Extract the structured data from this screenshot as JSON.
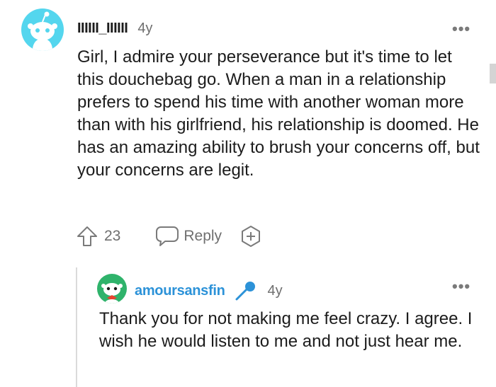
{
  "comment": {
    "username": "IIIIII_IIIIII",
    "age": "4y",
    "body": "Girl, I admire your perseverance but it's time to let this douchebag go. When a man in a relationship prefers to spend his time with another woman more than with his girlfriend, his relationship is doomed. He has an amazing ability to brush your concerns off, but your concerns are legit.",
    "upvotes": "23",
    "reply_label": "Reply",
    "menu": "•••"
  },
  "reply": {
    "username": "amoursansfin",
    "age": "4y",
    "body": "Thank you for not making me feel crazy. I agree. I wish he would listen to me and not just hear me.",
    "menu": "•••"
  },
  "icons": [
    "avatar",
    "upvote-arrow-icon",
    "reply-bubble-icon",
    "award-plus-icon",
    "more-options-icon",
    "microphone-icon"
  ],
  "colors": {
    "avatar_bg": "#54d6ee",
    "reply_avatar_bg": "#2fb36b",
    "reply_username": "#2c92d8",
    "mic": "#2c92d8",
    "muted": "#6f6f6f"
  }
}
